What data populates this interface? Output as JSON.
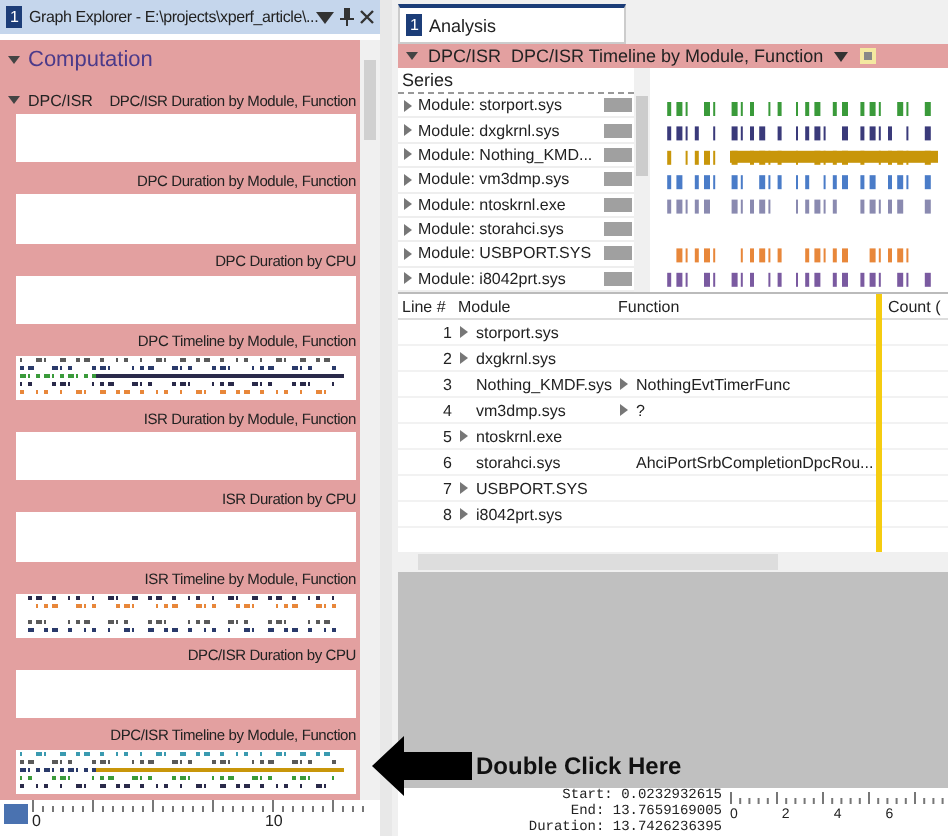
{
  "graph_explorer": {
    "badge": "1",
    "title": "Graph Explorer - E:\\projects\\xperf_article\\...",
    "category": "Computation",
    "group": "DPC/ISR",
    "graphs": [
      {
        "title": "DPC/ISR Duration by Module, Function",
        "kind": "empty"
      },
      {
        "title": "DPC Duration by Module, Function",
        "kind": "empty"
      },
      {
        "title": "DPC Duration by CPU",
        "kind": "empty"
      },
      {
        "title": "DPC Timeline by Module, Function",
        "kind": "timeline"
      },
      {
        "title": "ISR Duration by Module, Function",
        "kind": "empty"
      },
      {
        "title": "ISR Duration by CPU",
        "kind": "empty"
      },
      {
        "title": "ISR Timeline by Module, Function",
        "kind": "timeline"
      },
      {
        "title": "DPC/ISR Duration by CPU",
        "kind": "empty"
      },
      {
        "title": "DPC/ISR Timeline by Module, Function",
        "kind": "timeline"
      }
    ],
    "axis_labels": [
      "0",
      "10"
    ]
  },
  "analysis": {
    "tab": {
      "badge": "1",
      "label": "Analysis",
      "selected": true
    },
    "header": {
      "group": "DPC/ISR",
      "graph": "DPC/ISR Timeline by Module, Function"
    },
    "series_heading": "Series",
    "series": [
      {
        "name": "Module: storport.sys",
        "color": "#3a9a3a"
      },
      {
        "name": "Module: dxgkrnl.sys",
        "color": "#3a3a7a"
      },
      {
        "name": "Module: Nothing_KMD...",
        "color": "#c8960a"
      },
      {
        "name": "Module: vm3dmp.sys",
        "color": "#4a7cc8"
      },
      {
        "name": "Module: ntoskrnl.exe",
        "color": "#8a8ab0"
      },
      {
        "name": "Module: storahci.sys"
      },
      {
        "name": "Module: USBPORT.SYS",
        "color": "#e8873a"
      },
      {
        "name": "Module: i8042prt.sys",
        "color": "#7a5aa0"
      }
    ],
    "table": {
      "columns": [
        "Line #",
        "Module",
        "Function",
        "Count ("
      ],
      "rows": [
        {
          "line": "1",
          "module": "storport.sys",
          "module_expandable": true,
          "function": "",
          "function_expandable": false
        },
        {
          "line": "2",
          "module": "dxgkrnl.sys",
          "module_expandable": true,
          "function": "",
          "function_expandable": false
        },
        {
          "line": "3",
          "module": "Nothing_KMDF.sys",
          "module_expandable": false,
          "function": "NothingEvtTimerFunc",
          "function_expandable": true
        },
        {
          "line": "4",
          "module": "vm3dmp.sys",
          "module_expandable": false,
          "function": "?",
          "function_expandable": true
        },
        {
          "line": "5",
          "module": "ntoskrnl.exe",
          "module_expandable": true,
          "function": "",
          "function_expandable": false
        },
        {
          "line": "6",
          "module": "storahci.sys",
          "module_expandable": false,
          "function": "AhciPortSrbCompletionDpcRou...",
          "function_expandable": false
        },
        {
          "line": "7",
          "module": "USBPORT.SYS",
          "module_expandable": true,
          "function": "",
          "function_expandable": false
        },
        {
          "line": "8",
          "module": "i8042prt.sys",
          "module_expandable": true,
          "function": "",
          "function_expandable": false
        }
      ]
    },
    "time_range": [
      {
        "label": "Start:",
        "value": "0.0232932615"
      },
      {
        "label": "End:",
        "value": "13.7659169005"
      },
      {
        "label": "Duration:",
        "value": "13.7426236395"
      }
    ],
    "axis_labels": [
      "0",
      "2",
      "4",
      "6"
    ]
  },
  "callout": "Double Click Here"
}
